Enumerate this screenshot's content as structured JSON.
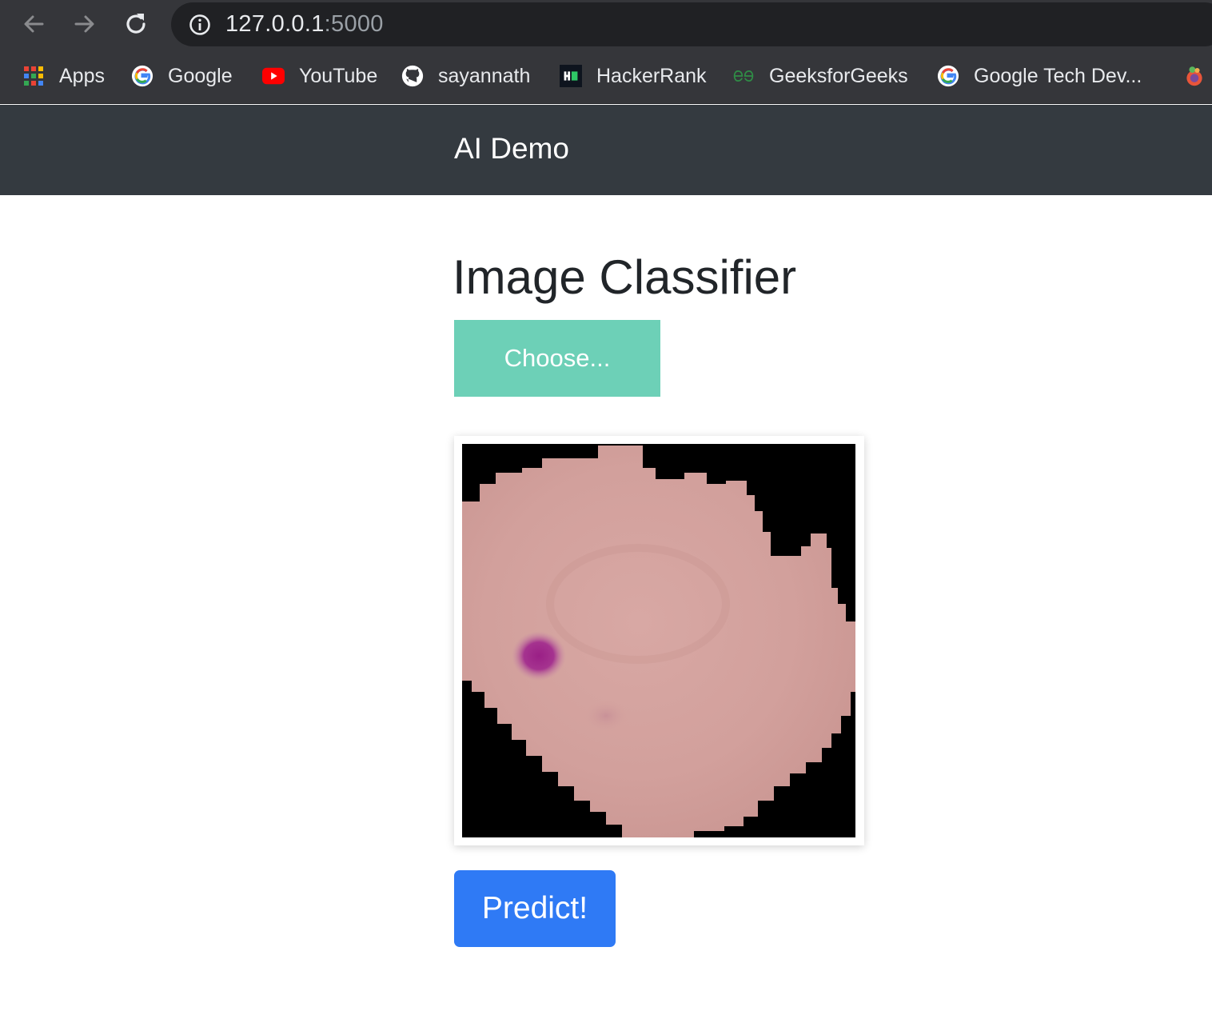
{
  "browser": {
    "url_host": "127.0.0.1",
    "url_port": ":5000",
    "bookmarks": [
      {
        "label": "Apps",
        "icon": "apps-grid-icon"
      },
      {
        "label": "Google",
        "icon": "google-icon"
      },
      {
        "label": "YouTube",
        "icon": "youtube-icon"
      },
      {
        "label": "sayannath",
        "icon": "github-icon"
      },
      {
        "label": "HackerRank",
        "icon": "hackerrank-icon"
      },
      {
        "label": "GeeksforGeeks",
        "icon": "geeksforgeeks-icon"
      },
      {
        "label": "Google Tech Dev...",
        "icon": "google-icon"
      }
    ]
  },
  "navbar": {
    "brand": "AI Demo"
  },
  "main": {
    "title": "Image Classifier",
    "choose_label": "Choose...",
    "predict_label": "Predict!"
  },
  "colors": {
    "navbar_bg": "#343a40",
    "choose_bg": "#6dd0b7",
    "predict_bg": "#2f7af5",
    "cell_fill": "#d4a19d",
    "stain": "#a3278a"
  }
}
